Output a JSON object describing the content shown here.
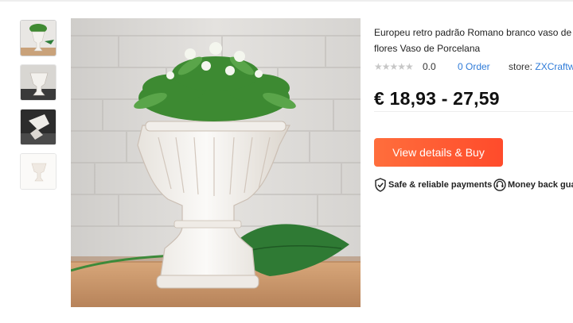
{
  "product": {
    "title_line1": "Europeu retro padrão Romano branco vaso de",
    "title_line2": "flores Vaso de Porcelana",
    "stars": "★★★★★",
    "rating": "0.0",
    "orders": "0 Order",
    "store_label": "store:",
    "store_name": "ZXCraftwo",
    "price": "€ 18,93 - 27,59",
    "buy_button": "View details & Buy",
    "guarantee_1": "Safe & reliable payments",
    "guarantee_2": "Money back gua"
  },
  "colors": {
    "accent": "#ff4b2b",
    "link": "#2f7bd8"
  },
  "icons": [
    "shield-check-icon",
    "headset-icon",
    "star-icon"
  ]
}
